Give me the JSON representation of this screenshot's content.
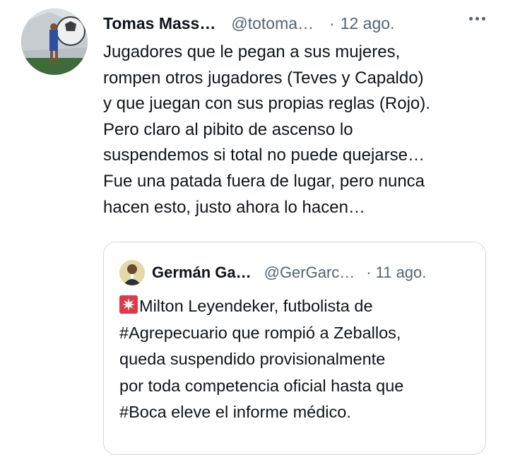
{
  "tweet": {
    "author_name": "Tomas Mass…",
    "author_handle": "@totoma…",
    "separator": "·",
    "time": "12 ago.",
    "text_lines": [
      "Jugadores que le pegan a sus mujeres,",
      "rompen otros jugadores (Teves y Capaldo)",
      "y que juegan con sus propias reglas (Rojo).",
      "Pero claro al pibito de ascenso lo",
      "suspendemos si total no puede quejarse…",
      "Fue una patada fuera de lugar, pero nunca",
      "hacen esto, justo ahora lo hacen…"
    ]
  },
  "quoted_tweet": {
    "author_name": "Germán Ga…",
    "author_handle": "@GerGarc…",
    "separator": "·",
    "time": "11 ago.",
    "lead_icon": "rotating-light-icon",
    "text_lines": [
      "Milton Leyendeker, futbolista de",
      "#Agrepecuario que rompió a Zeballos,",
      "queda suspendido provisionalmente",
      "por toda competencia oficial hasta que",
      "#Boca eleve el informe médico."
    ]
  },
  "colors": {
    "text": "#0f1419",
    "secondary": "#536471",
    "border": "#cfd9de"
  }
}
